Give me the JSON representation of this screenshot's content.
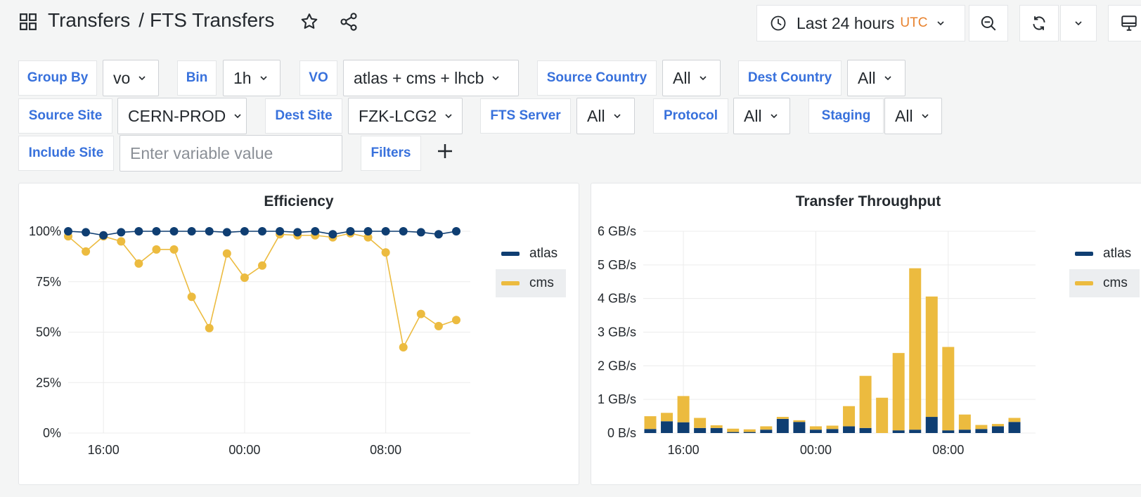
{
  "header": {
    "breadcrumb_parent": "Transfers",
    "breadcrumb_separator": "/",
    "dashboard_title": "FTS Transfers"
  },
  "time_picker": {
    "range_label": "Last 24 hours",
    "timezone": "UTC"
  },
  "variables": {
    "group_by": {
      "label": "Group By",
      "value": "vo"
    },
    "bin": {
      "label": "Bin",
      "value": "1h"
    },
    "vo": {
      "label": "VO",
      "value": "atlas + cms + lhcb"
    },
    "source_country": {
      "label": "Source Country",
      "value": "All"
    },
    "dest_country": {
      "label": "Dest Country",
      "value": "All"
    },
    "source_site": {
      "label": "Source Site",
      "value": "CERN-PROD"
    },
    "dest_site": {
      "label": "Dest Site",
      "value": "FZK-LCG2"
    },
    "fts_server": {
      "label": "FTS Server",
      "value": "All"
    },
    "protocol": {
      "label": "Protocol",
      "value": "All"
    },
    "staging": {
      "label": "Staging",
      "value": "All"
    },
    "include_site": {
      "label": "Include Site",
      "placeholder": "Enter variable value"
    },
    "filters": {
      "label": "Filters"
    }
  },
  "colors": {
    "atlas": "#0f3e72",
    "cms": "#ecbb3f",
    "link": "#3871dc",
    "utc": "#e8822e"
  },
  "chart_data": [
    {
      "type": "line",
      "title": "Efficiency",
      "x_ticks": [
        "16:00",
        "00:00",
        "08:00"
      ],
      "y_ticks": [
        "0%",
        "25%",
        "50%",
        "75%",
        "100%"
      ],
      "ylim": [
        0,
        100
      ],
      "series": [
        {
          "name": "atlas",
          "color": "#0f3e72",
          "values": [
            100,
            99.5,
            98,
            99.5,
            100,
            100,
            100,
            100,
            100,
            99.5,
            100,
            100,
            100,
            99.5,
            100,
            98.5,
            100,
            100,
            100,
            100,
            99.5,
            98.5,
            100
          ]
        },
        {
          "name": "cms",
          "color": "#ecbb3f",
          "values": [
            97.5,
            90,
            97.5,
            95,
            84,
            91,
            91,
            67.5,
            52,
            89,
            77,
            83,
            98.5,
            98,
            98,
            97,
            99,
            97,
            89.5,
            42.5,
            59,
            53,
            56
          ]
        }
      ],
      "legend": [
        "atlas",
        "cms"
      ]
    },
    {
      "type": "bar",
      "stacked": true,
      "title": "Transfer Throughput",
      "x_ticks": [
        "16:00",
        "00:00",
        "08:00"
      ],
      "y_ticks": [
        "0 B/s",
        "1 GB/s",
        "2 GB/s",
        "3 GB/s",
        "4 GB/s",
        "5 GB/s",
        "6 GB/s"
      ],
      "ylim": [
        0,
        6
      ],
      "unit": "GB/s",
      "series": [
        {
          "name": "atlas",
          "color": "#0f3e72",
          "values": [
            0.12,
            0.35,
            0.32,
            0.15,
            0.15,
            0.03,
            0.03,
            0.1,
            0.42,
            0.33,
            0.1,
            0.12,
            0.2,
            0.15,
            0.0,
            0.08,
            0.1,
            0.48,
            0.08,
            0.1,
            0.12,
            0.2,
            0.33
          ]
        },
        {
          "name": "cms",
          "color": "#ecbb3f",
          "values": [
            0.38,
            0.25,
            0.78,
            0.3,
            0.08,
            0.1,
            0.08,
            0.1,
            0.06,
            0.05,
            0.1,
            0.1,
            0.6,
            1.55,
            1.05,
            2.3,
            4.8,
            3.58,
            2.48,
            0.45,
            0.12,
            0.07,
            0.12
          ]
        }
      ],
      "legend": [
        "atlas",
        "cms"
      ]
    }
  ]
}
